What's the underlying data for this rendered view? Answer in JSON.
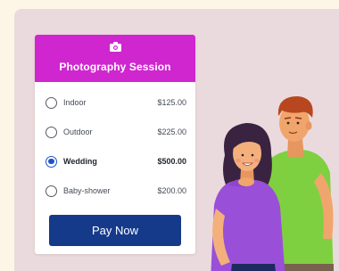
{
  "card": {
    "title": "Photography Session",
    "icon": "camera-icon",
    "options": [
      {
        "label": "Indoor",
        "price": "$125.00",
        "selected": false
      },
      {
        "label": "Outdoor",
        "price": "$225.00",
        "selected": false
      },
      {
        "label": "Wedding",
        "price": "$500.00",
        "selected": true
      },
      {
        "label": "Baby-shower",
        "price": "$200.00",
        "selected": false
      }
    ],
    "pay_label": "Pay Now"
  },
  "colors": {
    "background": "#fdf6e6",
    "panel": "#ebdadd",
    "header": "#cf26cf",
    "button": "#153a8a",
    "radio_selected": "#1f53c7"
  }
}
